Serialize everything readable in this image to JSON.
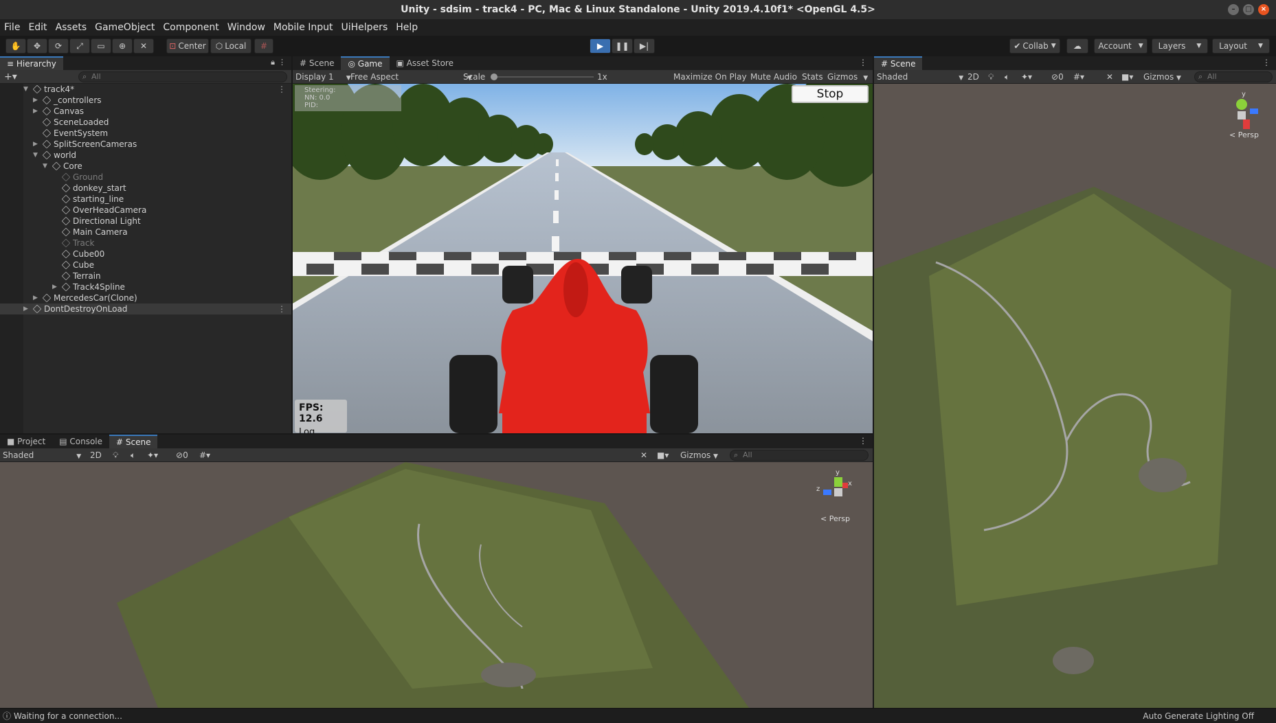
{
  "window": {
    "title": "Unity - sdsim - track4 - PC, Mac & Linux Standalone - Unity 2019.4.10f1* <OpenGL 4.5>"
  },
  "menu": [
    "File",
    "Edit",
    "Assets",
    "GameObject",
    "Component",
    "Window",
    "Mobile Input",
    "UiHelpers",
    "Help"
  ],
  "toolbar": {
    "pivot": "Center",
    "space": "Local",
    "collab": "Collab",
    "account": "Account",
    "layers": "Layers",
    "layout": "Layout"
  },
  "hierarchy": {
    "tab": "Hierarchy",
    "search_placeholder": "All",
    "rows": [
      {
        "label": "track4*"
      },
      {
        "label": "_controllers"
      },
      {
        "label": "Canvas"
      },
      {
        "label": "SceneLoaded"
      },
      {
        "label": "EventSystem"
      },
      {
        "label": "SplitScreenCameras"
      },
      {
        "label": "world"
      },
      {
        "label": "Core"
      },
      {
        "label": "Ground"
      },
      {
        "label": "donkey_start"
      },
      {
        "label": "starting_line"
      },
      {
        "label": "OverHeadCamera"
      },
      {
        "label": "Directional Light"
      },
      {
        "label": "Main Camera"
      },
      {
        "label": "Track"
      },
      {
        "label": "Cube00"
      },
      {
        "label": "Cube"
      },
      {
        "label": "Terrain"
      },
      {
        "label": "Track4Spline"
      },
      {
        "label": "MercedesCar(Clone)"
      },
      {
        "label": "DontDestroyOnLoad"
      }
    ]
  },
  "game_view": {
    "tabs": [
      "Scene",
      "Game",
      "Asset Store"
    ],
    "display": "Display 1",
    "aspect": "Free Aspect",
    "scale_label": "Scale",
    "scale_value": "1x",
    "maximize": "Maximize On Play",
    "mute": "Mute Audio",
    "stats": "Stats",
    "gizmos": "Gizmos",
    "overlay_lines": [
      "Steering:",
      "NN: 0.0",
      "PID:"
    ],
    "stop_button": "Stop",
    "fps": "FPS: 12.6",
    "log_count": "Log Count"
  },
  "right_scene": {
    "tab": "Scene",
    "shading": "Shaded",
    "mode_2d": "2D",
    "hidden_count": "0",
    "gizmos": "Gizmos",
    "search_placeholder": "All",
    "persp": "Persp"
  },
  "bottom_scene": {
    "tabs": [
      "Project",
      "Console",
      "Scene"
    ],
    "shading": "Shaded",
    "mode_2d": "2D",
    "hidden_count": "0",
    "gizmos": "Gizmos",
    "search_placeholder": "All",
    "persp": "Persp"
  },
  "status": {
    "message": "Waiting for a connection...",
    "lighting": "Auto Generate Lighting Off"
  }
}
